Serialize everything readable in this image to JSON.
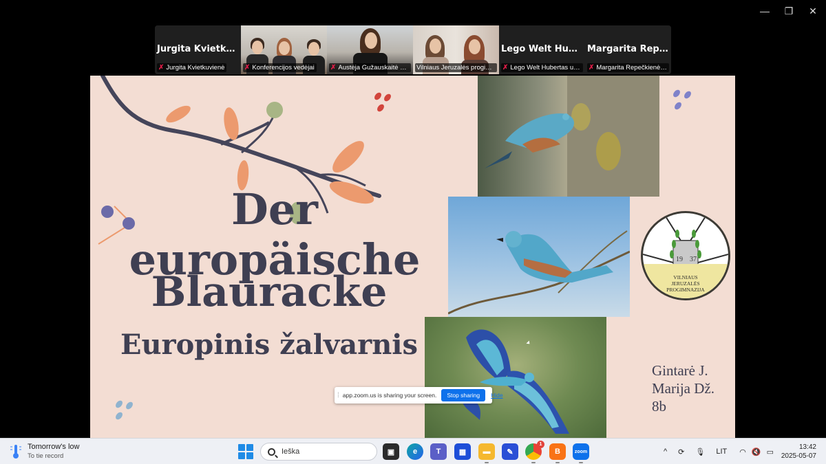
{
  "window": {
    "min_glyph": "—",
    "max_glyph": "❐",
    "close_glyph": "✕"
  },
  "participants": [
    {
      "big_name": "Jurgita  Kvietkuv...",
      "label": "Jurgita Kvietkuvienė",
      "video": false
    },
    {
      "big_name": "",
      "label": "Konferencijos vedėjai",
      "video": true
    },
    {
      "big_name": "",
      "label": "Austėja Gužauskaitė 8c...",
      "video": true
    },
    {
      "big_name": "",
      "label": "Vilniaus Jeruzalės progim...",
      "video": true,
      "active": true
    },
    {
      "big_name": "Lego  Welt  Hube...",
      "label": "Lego Welt Hubertas un...",
      "video": false
    },
    {
      "big_name": "Margarita  Repe...",
      "label": "Margarita Repečkienė, ...",
      "video": false
    }
  ],
  "slide": {
    "title_line1": "Der europäische",
    "title_line2": "Blauracke",
    "subtitle": "Europinis žalvarnis",
    "authors": [
      "Gintarė J.",
      "Marija Dž.",
      "8b"
    ],
    "logo": {
      "year_left": "19",
      "year_right": "37",
      "text_lines": [
        "VILNIAUS",
        "JERUZALĖS",
        "PROGIMNAZIJA"
      ]
    }
  },
  "share_bar": {
    "text": "app.zoom.us is sharing your screen.",
    "stop_label": "Stop sharing",
    "hide_label": "Hide"
  },
  "taskbar": {
    "weather_title": "Tomorrow's low",
    "weather_sub": "To tie record",
    "search_placeholder": "Ieška",
    "language": "LIT",
    "time": "13:42",
    "date": "2025-05-07",
    "chrome_badge": "1",
    "zoom_label": "zoom"
  },
  "colors": {
    "slide_bg": "#f3ddd3",
    "title_text": "#3f3f52",
    "active_tile": "#22c55e",
    "zoom_blue": "#0e71eb"
  }
}
